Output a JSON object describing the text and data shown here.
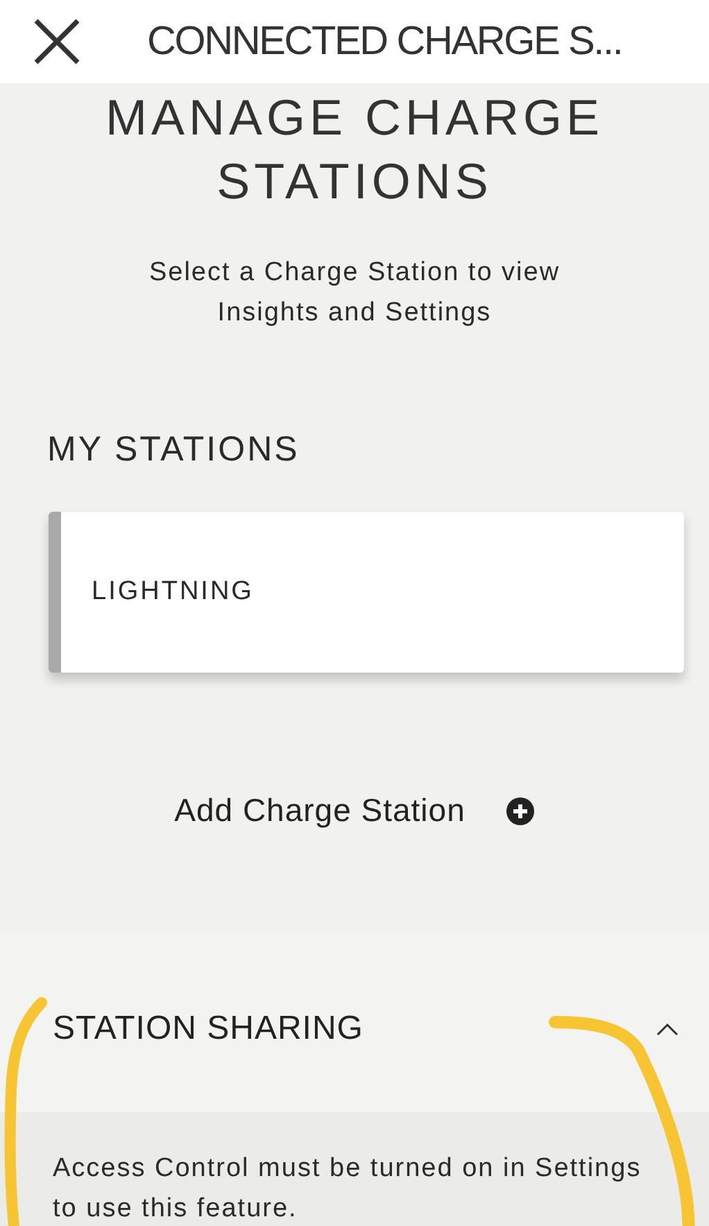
{
  "header": {
    "title": "CONNECTED CHARGE S..."
  },
  "heading": "MANAGE CHARGE STATIONS",
  "subtitle": "Select a Charge Station to view Insights and Settings",
  "my_stations": {
    "title": "MY STATIONS",
    "stations": [
      {
        "name": "LIGHTNING"
      }
    ]
  },
  "add_station": {
    "label": "Add Charge Station"
  },
  "station_sharing": {
    "title": "STATION SHARING",
    "expanded": true,
    "message": "Access Control must be turned on in Settings to use this feature."
  }
}
